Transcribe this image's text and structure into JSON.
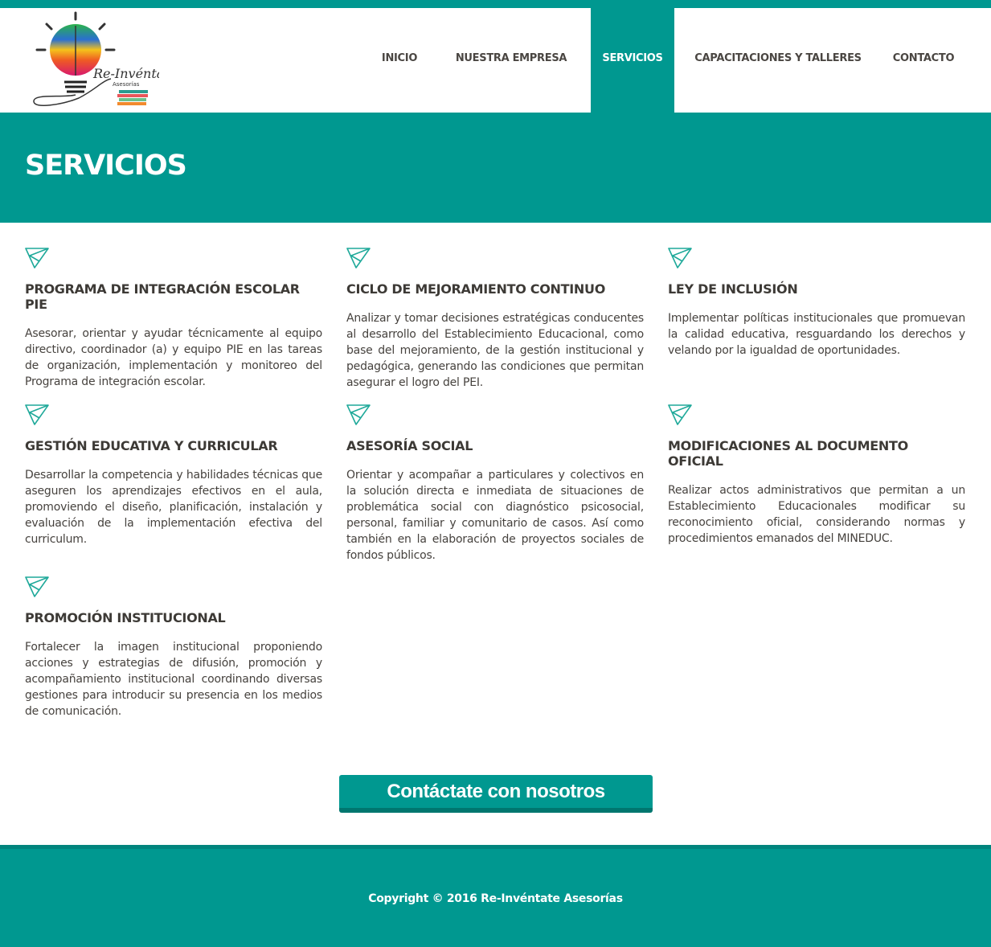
{
  "brand": {
    "name": "Re-Invéntate",
    "sub": "Asesorías"
  },
  "nav": [
    {
      "label": "INICIO"
    },
    {
      "label": "NUESTRA EMPRESA"
    },
    {
      "label": "SERVICIOS"
    },
    {
      "label": "CAPACITACIONES Y TALLERES"
    },
    {
      "label": "CONTACTO"
    }
  ],
  "hero": {
    "title": "SERVICIOS"
  },
  "services": [
    {
      "title": "PROGRAMA DE INTEGRACIÓN ESCOLAR PIE",
      "text": "Asesorar, orientar y ayudar técnicamente al equipo directivo, coordinador (a) y equipo PIE en las tareas de organización, implementación y monitoreo del Programa de integración escolar."
    },
    {
      "title": "CICLO DE MEJORAMIENTO CONTINUO",
      "text": "Analizar y tomar decisiones estratégicas conducentes al desarrollo del Establecimiento Educacional, como base del mejoramiento, de la gestión institucional y pedagógica, generando las condiciones que permitan asegurar el logro del PEI."
    },
    {
      "title": "LEY DE INCLUSIÓN",
      "text": "Implementar políticas institucionales que promuevan la calidad educativa, resguardando los derechos y velando por la igualdad de oportunidades."
    },
    {
      "title": "GESTIÓN EDUCATIVA Y CURRICULAR",
      "text": "Desarrollar la competencia y habilidades técnicas que aseguren los aprendizajes efectivos en el aula, promoviendo el diseño, planificación, instalación y evaluación de la implementación efectiva del curriculum."
    },
    {
      "title": "ASESORÍA SOCIAL",
      "text": "Orientar y acompañar a particulares y colectivos en la solución directa e inmediata de situaciones de problemática social con diagnóstico psicosocial, personal, familiar y comunitario de casos. Así como también en la elaboración de proyectos sociales de fondos públicos."
    },
    {
      "title": "MODIFICACIONES AL DOCUMENTO OFICIAL",
      "text": "Realizar actos administrativos que permitan a un Establecimiento Educacionales modificar su reconocimiento oficial, considerando normas y procedimientos emanados del MINEDUC."
    },
    {
      "title": "PROMOCIÓN INSTITUCIONAL",
      "text": "Fortalecer la imagen institucional proponiendo acciones y estrategias de difusión, promoción y acompañamiento institucional coordinando diversas gestiones para introducir su presencia en los medios de comunicación."
    }
  ],
  "cta": {
    "label": "Contáctate con nosotros"
  },
  "footer": {
    "copyright": "Copyright © 2016 Re-Invéntate Asesorías"
  },
  "colors": {
    "accent": "#009890",
    "text": "#3d3a36"
  }
}
